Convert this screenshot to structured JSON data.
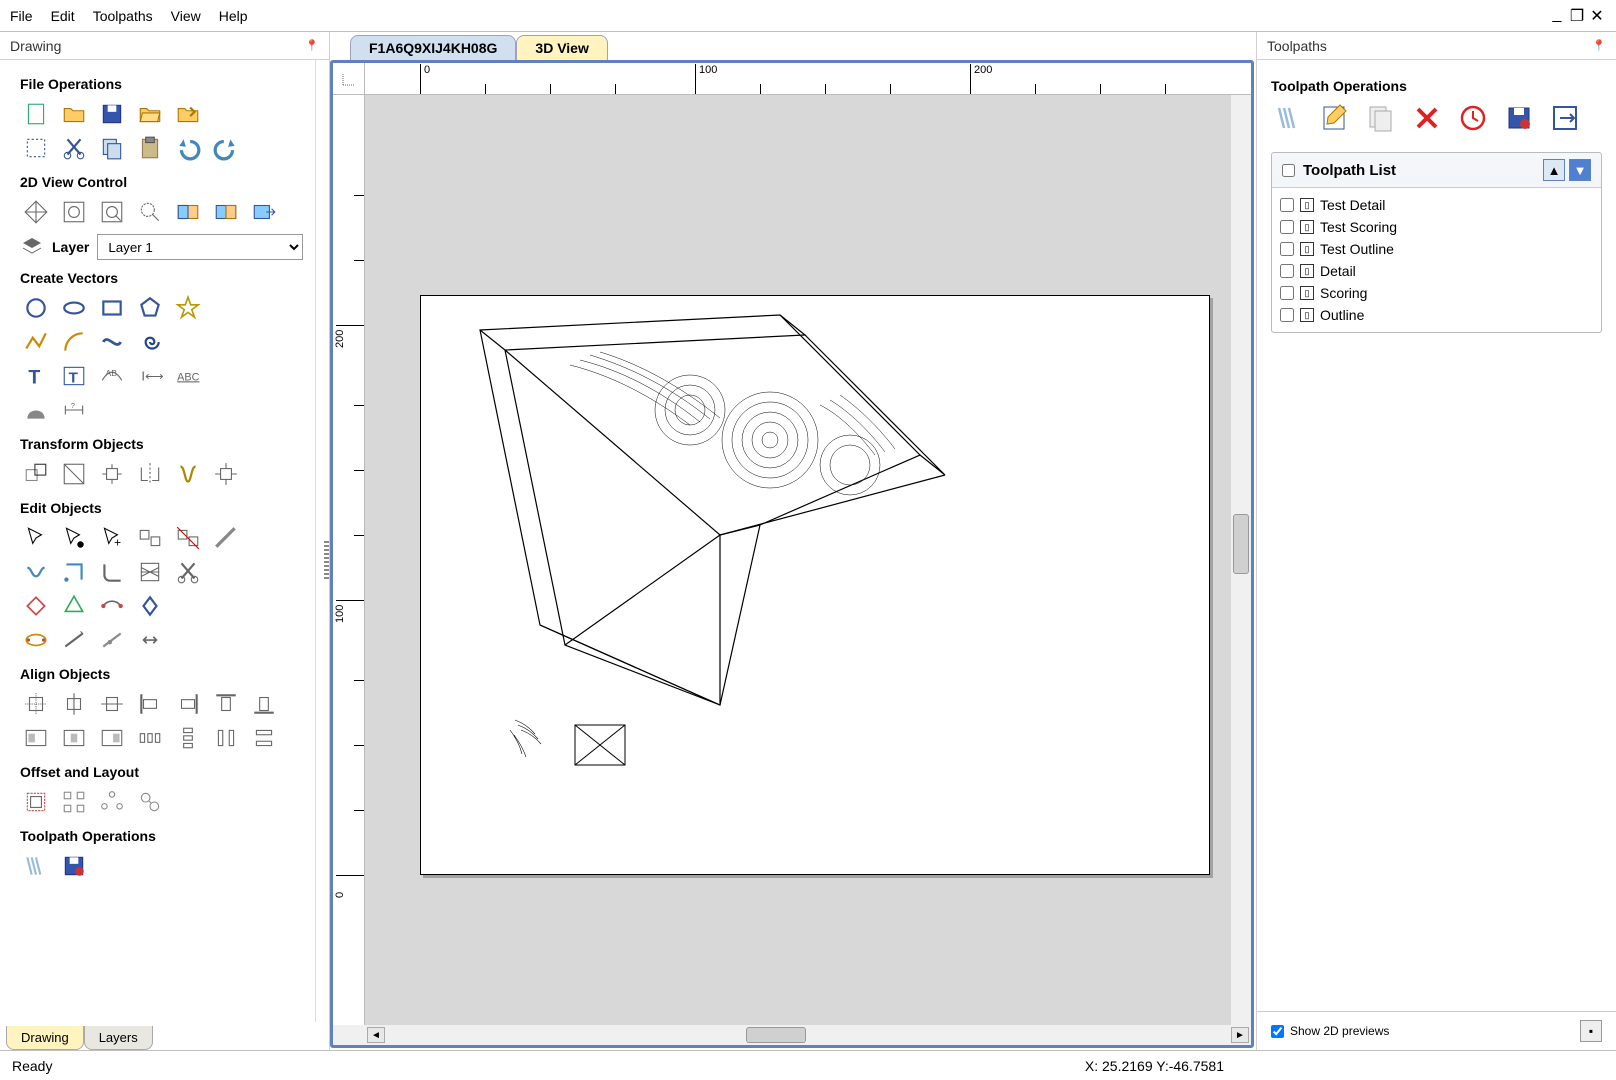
{
  "menu": [
    "File",
    "Edit",
    "Toolpaths",
    "View",
    "Help"
  ],
  "panels": {
    "left_title": "Drawing",
    "right_title": "Toolpaths"
  },
  "left": {
    "sections": {
      "file_ops": "File Operations",
      "view_ctrl": "2D View Control",
      "layer_label": "Layer",
      "layer_value": "Layer 1",
      "create_vec": "Create Vectors",
      "transform": "Transform Objects",
      "edit_obj": "Edit Objects",
      "align": "Align Objects",
      "offset": "Offset and Layout",
      "tp_ops": "Toolpath Operations"
    },
    "tabs": {
      "drawing": "Drawing",
      "layers": "Layers"
    }
  },
  "center": {
    "tabs": {
      "file": "F1A6Q9XIJ4KH08G",
      "view3d": "3D View"
    },
    "ruler_h": [
      "0",
      "100",
      "200"
    ],
    "ruler_v": [
      "0",
      "100",
      "200"
    ]
  },
  "right": {
    "ops_title": "Toolpath Operations",
    "list_title": "Toolpath List",
    "items": [
      "Test Detail",
      "Test Scoring",
      "Test Outline",
      "Detail",
      "Scoring",
      "Outline"
    ],
    "show_previews": "Show 2D previews"
  },
  "status": {
    "left": "Ready",
    "coords": "X: 25.2169 Y:-46.7581"
  }
}
